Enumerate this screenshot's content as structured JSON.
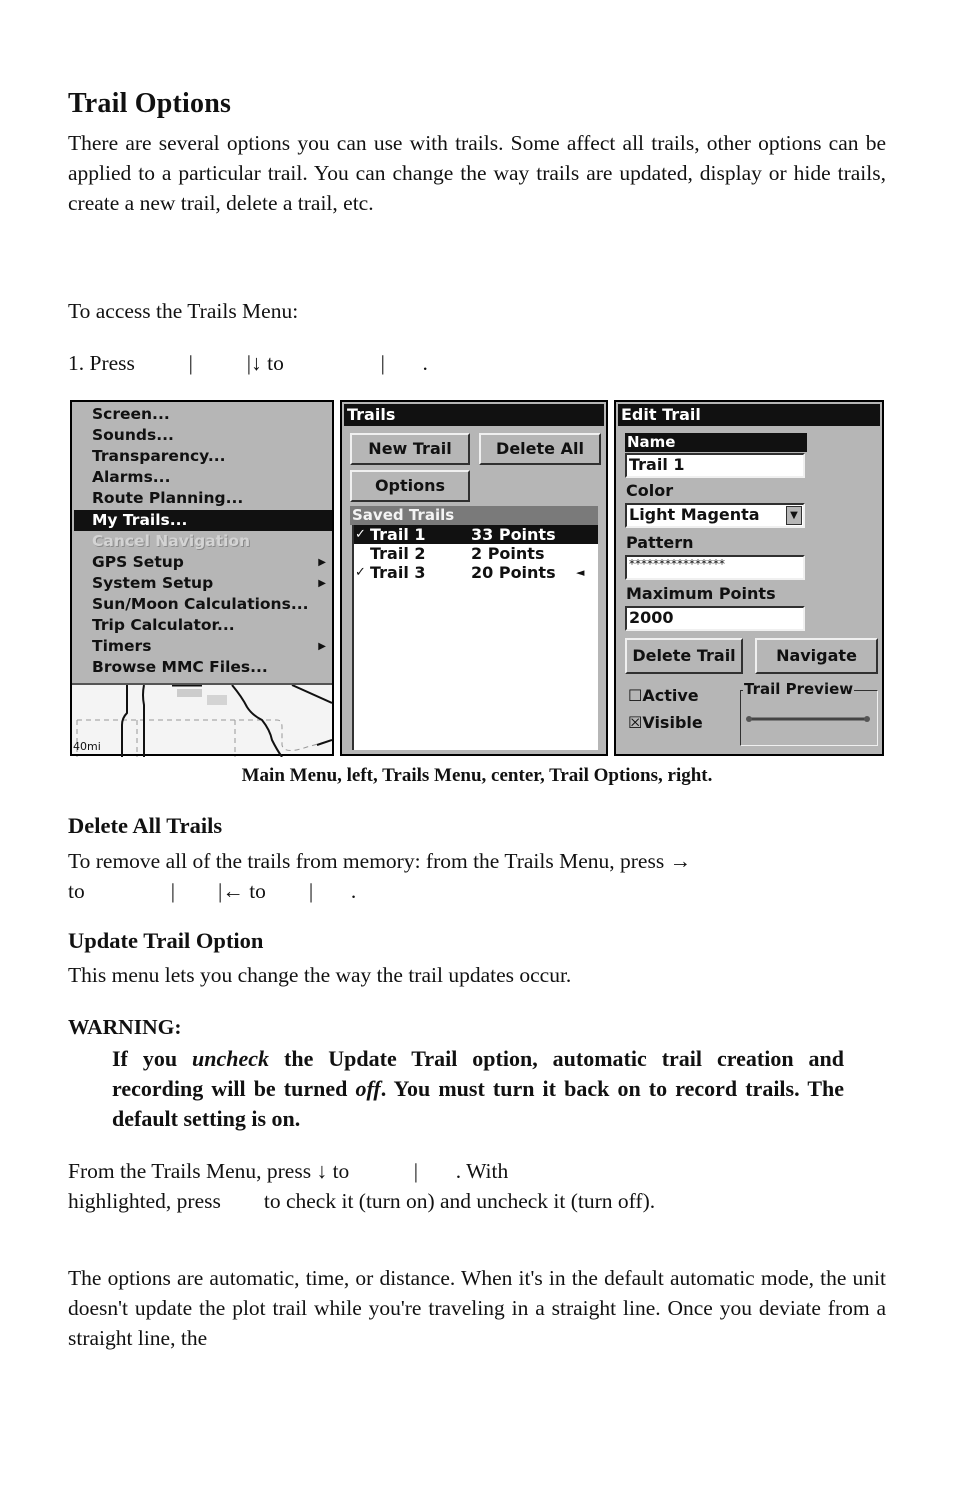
{
  "page": {
    "title": "Trail Options",
    "intro": "There are several options you can use with trails. Some affect all trails, other options can be applied to a particular trail. You can change the way trails are updated, display or hide trails, create a new trail, delete a trail, etc.",
    "access_label": "To access the Trails Menu:",
    "step1": "1. Press          |          |↓ to                  |       .",
    "caption": "Main Menu, left, Trails Menu, center, Trail Options, right.",
    "delete_all": {
      "heading": "Delete All Trails",
      "line1": "To remove all of the trails from memory: from the Trails Menu, press →",
      "line2": "to                |        |← to        |       ."
    },
    "update_trail": {
      "heading": "Update Trail Option",
      "body": "This menu lets you change the way the trail updates occur."
    },
    "warning": {
      "label": "WARNING:",
      "part1": "If you ",
      "em1": "uncheck",
      "part2": " the Update Trail option, automatic trail creation and recording will be turned ",
      "em2": "off",
      "part3": ". You must turn it back on to record trails. The default setting is on."
    },
    "from_trails": {
      "line1": "From the Trails Menu, press ↓ to            |       . With",
      "line2": "highlighted, press        to check it (turn on) and uncheck it (turn off)."
    },
    "options_para": "The options are automatic, time, or distance. When it's in the default automatic mode, the unit doesn't update the plot trail while you're traveling in a straight line. Once you deviate from a straight line, the"
  },
  "main_menu": {
    "items": [
      {
        "label": "Screen...",
        "state": "normal",
        "submenu": false
      },
      {
        "label": "Sounds...",
        "state": "normal",
        "submenu": false
      },
      {
        "label": "Transparency...",
        "state": "normal",
        "submenu": false
      },
      {
        "label": "Alarms...",
        "state": "normal",
        "submenu": false
      },
      {
        "label": "Route Planning...",
        "state": "normal",
        "submenu": false
      },
      {
        "label": "My Trails...",
        "state": "selected",
        "submenu": false
      },
      {
        "label": "Cancel Navigation",
        "state": "disabled",
        "submenu": false
      },
      {
        "label": "GPS Setup",
        "state": "normal",
        "submenu": true
      },
      {
        "label": "System Setup",
        "state": "normal",
        "submenu": true
      },
      {
        "label": "Sun/Moon Calculations...",
        "state": "normal",
        "submenu": false
      },
      {
        "label": "Trip Calculator...",
        "state": "normal",
        "submenu": false
      },
      {
        "label": "Timers",
        "state": "normal",
        "submenu": true
      },
      {
        "label": "Browse MMC Files...",
        "state": "normal",
        "submenu": false
      }
    ],
    "map_scale": "40mi"
  },
  "trails_menu": {
    "title": "Trails",
    "new_trail": "New Trail",
    "delete_all": "Delete All",
    "options": "Options",
    "saved_header": "Saved Trails",
    "trails": [
      {
        "name": "Trail 1",
        "points": "33 Points",
        "checked": true,
        "selected": true,
        "active_marker": false
      },
      {
        "name": "Trail 2",
        "points": "2 Points",
        "checked": false,
        "selected": false,
        "active_marker": false
      },
      {
        "name": "Trail 3",
        "points": "20 Points",
        "checked": true,
        "selected": false,
        "active_marker": true
      }
    ]
  },
  "edit_trail": {
    "title": "Edit Trail",
    "name_label": "Name",
    "name_value": "Trail 1",
    "color_label": "Color",
    "color_value": "Light Magenta",
    "pattern_label": "Pattern",
    "pattern_value": "****************",
    "max_points_label": "Maximum Points",
    "max_points_value": "2000",
    "delete_trail": "Delete Trail",
    "navigate": "Navigate",
    "active_label": "Active",
    "active_checked": false,
    "visible_label": "Visible",
    "visible_checked": true,
    "preview_label": "Trail Preview"
  },
  "icons": {
    "check": "✓",
    "submenu_arrow": "▶",
    "dropdown": "▼",
    "active_arrow": "◄",
    "checkbox_checked": "☒",
    "checkbox_unchecked": "☐"
  }
}
